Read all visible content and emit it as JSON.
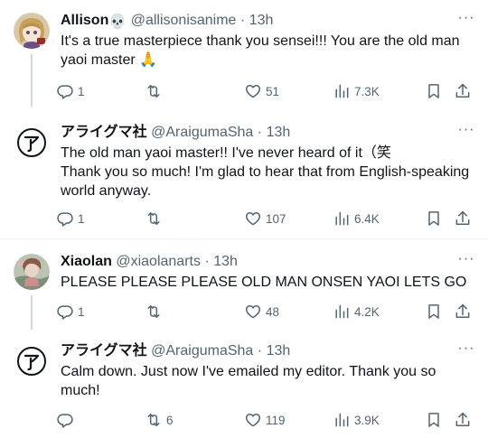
{
  "tweets": [
    {
      "name": "Allison",
      "name_emoji": "💀",
      "handle": "@allisonisanime",
      "time": "13h",
      "text": "It's a true masterpiece thank you sensei!!! You are the old man yaoi master 🙏",
      "replies": "1",
      "retweets": "",
      "likes": "51",
      "views": "7.3K"
    },
    {
      "name": "アライグマ社",
      "handle": "@AraigumaSha",
      "time": "13h",
      "text": "The old man yaoi master!! I've never heard of it（笑\nThank you so much! I'm glad to hear that from English-speaking world anyway.",
      "replies": "1",
      "retweets": "",
      "likes": "107",
      "views": "6.4K"
    },
    {
      "name": "Xiaolan",
      "handle": "@xiaolanarts",
      "time": "13h",
      "text": "PLEASE PLEASE PLEASE OLD MAN ONSEN YAOI LETS GO",
      "replies": "1",
      "retweets": "",
      "likes": "48",
      "views": "4.2K"
    },
    {
      "name": "アライグマ社",
      "handle": "@AraigumaSha",
      "time": "13h",
      "text": "Calm down. Just now I've emailed my editor. Thank you so much!",
      "replies": "",
      "retweets": "6",
      "likes": "119",
      "views": "3.9K"
    }
  ],
  "separator": "·",
  "more_label": "···",
  "icons": {
    "reply": "reply-icon",
    "retweet": "retweet-icon",
    "like": "heart-icon",
    "views": "views-icon",
    "bookmark": "bookmark-icon",
    "share": "share-icon"
  },
  "colors": {
    "text": "#0f1419",
    "secondary": "#536471",
    "thread_line": "#cfd9de",
    "divider": "#eff3f4"
  }
}
